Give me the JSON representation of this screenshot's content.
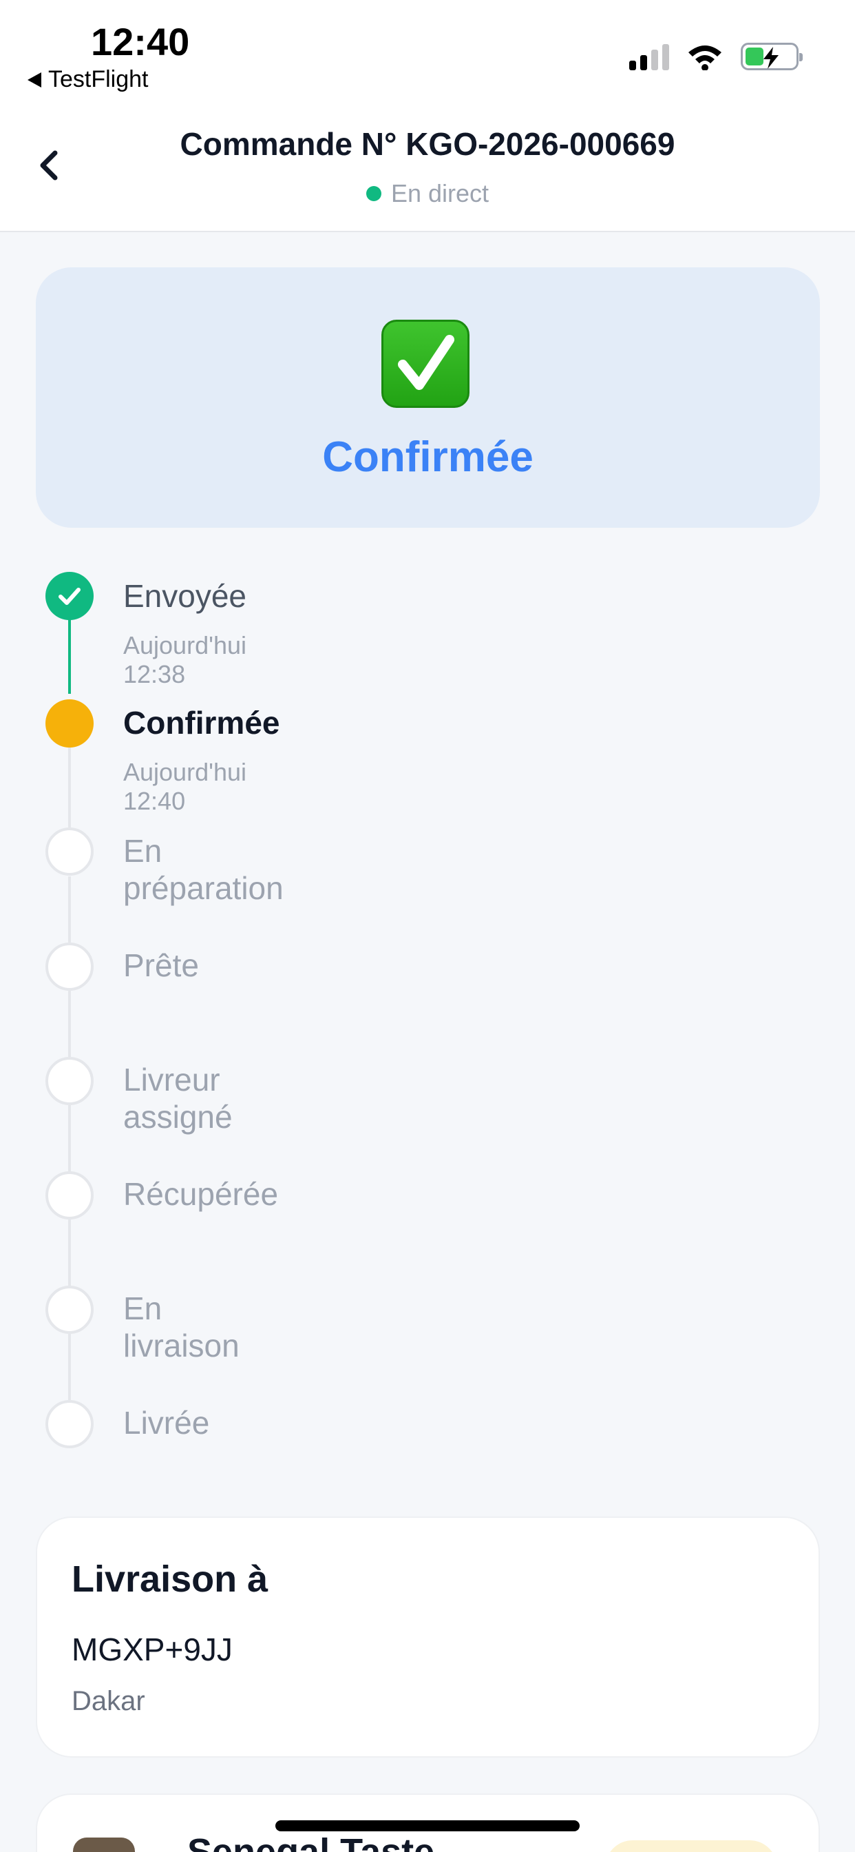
{
  "status_bar": {
    "time": "12:40",
    "back_app": "TestFlight",
    "icons": [
      "signal-icon",
      "wifi-icon",
      "battery-charging-icon"
    ]
  },
  "header": {
    "back_icon": "chevron-left-icon",
    "title": "Commande N° KGO-2026-000669",
    "live_label": "En direct"
  },
  "status_card": {
    "icon": "check-mark-icon",
    "label": "Confirmée"
  },
  "timeline": {
    "steps": [
      {
        "label": "Envoyée",
        "time": "Aujourd'hui 12:38",
        "state": "done"
      },
      {
        "label": "Confirmée",
        "time": "Aujourd'hui 12:40",
        "state": "current"
      },
      {
        "label": "En préparation",
        "state": "pending"
      },
      {
        "label": "Prête",
        "state": "pending"
      },
      {
        "label": "Livreur assigné",
        "state": "pending"
      },
      {
        "label": "Récupérée",
        "state": "pending"
      },
      {
        "label": "En livraison",
        "state": "pending"
      },
      {
        "label": "Livrée",
        "state": "pending"
      }
    ]
  },
  "delivery": {
    "title": "Livraison à",
    "address": "MGXP+9JJ",
    "city": "Dakar"
  },
  "restaurant": {
    "name": "Senegal Taste"
  },
  "colors": {
    "accent": "#3b82f6",
    "done": "#10b981",
    "current": "#f6b10a",
    "hero_bg": "#e3ecf8"
  }
}
